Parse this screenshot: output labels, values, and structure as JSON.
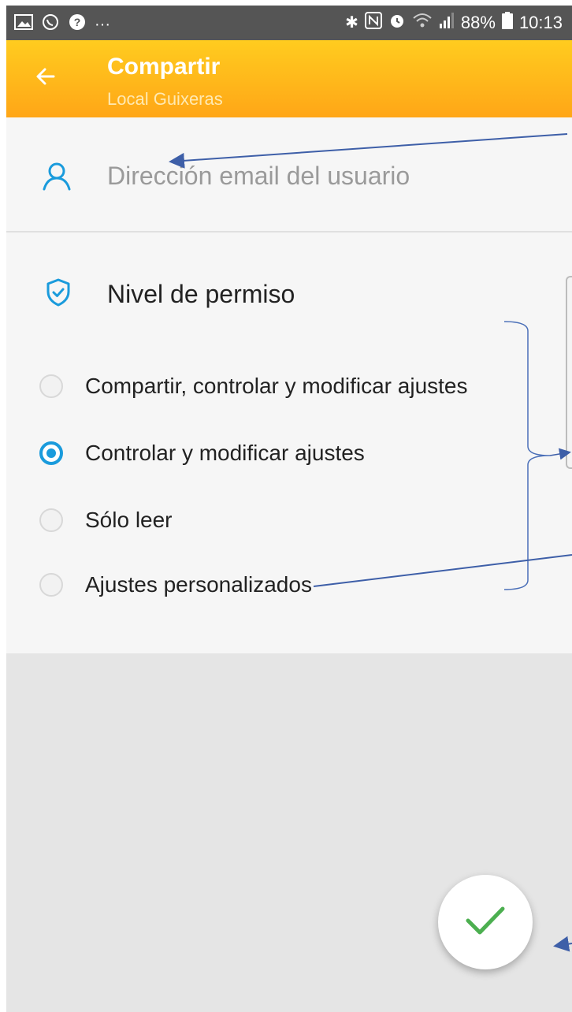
{
  "status_bar": {
    "left_icons": [
      "image-icon",
      "whatsapp-icon",
      "help-icon",
      "more-icon"
    ],
    "right_icons": [
      "bluetooth-icon",
      "nfc-icon",
      "alarm-icon",
      "wifi-icon",
      "signal-icon"
    ],
    "battery": "88%",
    "time": "10:13"
  },
  "app_bar": {
    "title": "Compartir",
    "subtitle": "Local Guixeras",
    "color_top": "#ffcc1f",
    "color_bottom": "#ffa617"
  },
  "email": {
    "placeholder": "Dirección email del usuario",
    "value": ""
  },
  "permissions": {
    "title": "Nivel de permiso",
    "options": [
      {
        "label": "Compartir, controlar y modificar ajustes",
        "selected": false
      },
      {
        "label": "Controlar y modificar ajustes",
        "selected": true
      },
      {
        "label": "Sólo leer",
        "selected": false
      },
      {
        "label": "Ajustes personalizados",
        "selected": false
      }
    ]
  },
  "accent_color": "#1a9bdc",
  "confirm_color": "#4caf50"
}
